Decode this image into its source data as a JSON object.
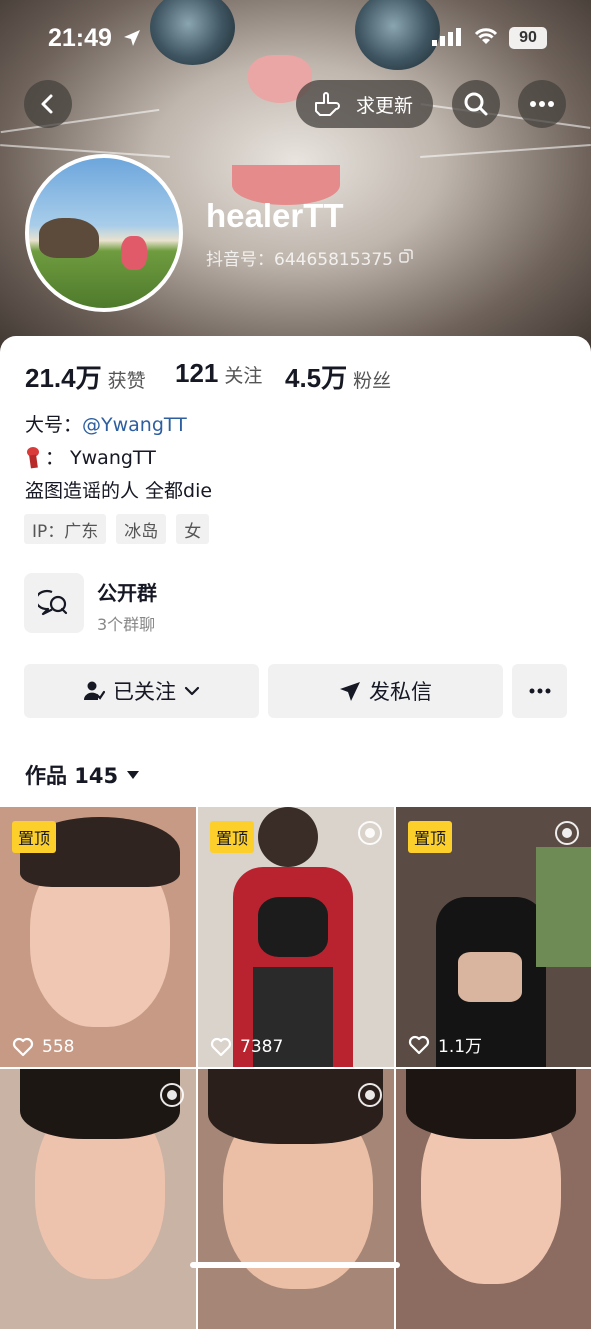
{
  "status_bar": {
    "time": "21:49",
    "battery": "90"
  },
  "header": {
    "request_update_label": "求更新"
  },
  "profile": {
    "username": "healerTT",
    "douyin_id": "抖音号：64465815375",
    "stats": [
      {
        "value": "21.4万",
        "label": "获赞"
      },
      {
        "value": "121",
        "label": "关注"
      },
      {
        "value": "4.5万",
        "label": "粉丝"
      }
    ],
    "bio": {
      "line1_prefix": "大号：",
      "line1_link": "@YwangTT",
      "line2": "：  YwangTT",
      "line3": "盗图造谣的人 全都die"
    },
    "tags": [
      "IP：广东",
      "冰岛",
      "女"
    ]
  },
  "group": {
    "title": "公开群",
    "subtitle": "3个群聊"
  },
  "actions": {
    "follow_label": "已关注",
    "message_label": "发私信"
  },
  "works": {
    "header": "作品 145",
    "items": [
      {
        "pinned": "置顶",
        "likes": "558",
        "bg": "#c79a86"
      },
      {
        "pinned": "置顶",
        "likes": "7387",
        "bg": "#d9d3cc"
      },
      {
        "pinned": "置顶",
        "likes": "1.1万",
        "bg": "#5a4c45"
      },
      {
        "bg": "#c9b3a5"
      },
      {
        "bg": "#a68676"
      },
      {
        "bg": "#8c6c60"
      }
    ]
  }
}
